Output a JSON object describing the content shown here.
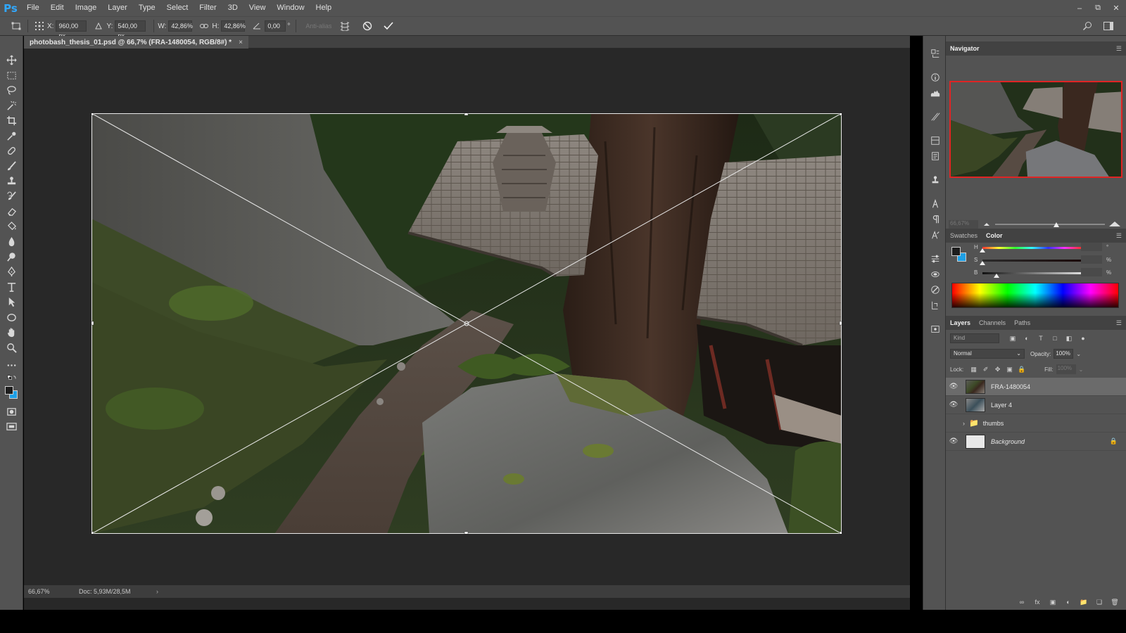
{
  "app": {
    "logo": "Ps"
  },
  "menu": [
    "File",
    "Edit",
    "Image",
    "Layer",
    "Type",
    "Select",
    "Filter",
    "3D",
    "View",
    "Window",
    "Help"
  ],
  "options": {
    "x_label": "X:",
    "x_value": "960,00 px",
    "y_label": "Y:",
    "y_value": "540,00 px",
    "w_label": "W:",
    "w_value": "42,86%",
    "h_label": "H:",
    "h_value": "42,86%",
    "angle_value": "0,00",
    "angle_unit": "°",
    "antialias_label": "Anti-alias"
  },
  "document": {
    "tab_title": "photobash_thesis_01.psd @ 66,7% (FRA-1480054, RGB/8#) *",
    "tab_close": "×"
  },
  "status": {
    "zoom": "66,67%",
    "doc_size": "Doc: 5,93M/28,5M",
    "arrow": "›"
  },
  "navigator": {
    "title": "Navigator"
  },
  "color_panel": {
    "tabs": [
      "Swatches",
      "Color"
    ],
    "active_tab": "Color",
    "sliders": [
      {
        "label": "H",
        "unit": "°",
        "level": 0.0
      },
      {
        "label": "S",
        "unit": "%",
        "level": 0.0
      },
      {
        "label": "B",
        "unit": "%",
        "level": 0.14
      }
    ],
    "foreground_color": "#1d1d1d",
    "background_color": "#1ea0e6"
  },
  "layers_panel": {
    "tabs": [
      "Layers",
      "Channels",
      "Paths"
    ],
    "active_tab": "Layers",
    "kind_label": "Kind",
    "blend_mode": "Normal",
    "opacity_label": "Opacity:",
    "opacity_value": "100%",
    "lock_label": "Lock:",
    "fill_label": "Fill:",
    "fill_value": "100%",
    "layers": [
      {
        "name": "FRA-1480054",
        "visible": true,
        "selected": true,
        "type": "photo"
      },
      {
        "name": "Layer 4",
        "visible": true,
        "selected": false,
        "type": "photo"
      },
      {
        "name": "thumbs",
        "visible": false,
        "selected": false,
        "type": "group"
      },
      {
        "name": "Background",
        "visible": true,
        "selected": false,
        "type": "background",
        "locked": true
      }
    ]
  },
  "colors": {
    "accent": "#31a8ff",
    "nav_frame": "#e02424"
  }
}
